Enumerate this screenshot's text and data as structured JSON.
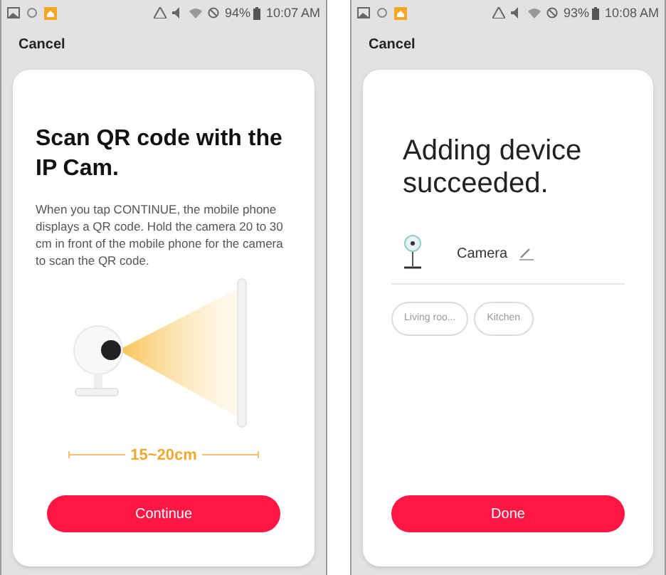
{
  "screens": [
    {
      "kind": "scan",
      "status_bar": {
        "battery": "94%",
        "time": "10:07 AM"
      },
      "cancel": "Cancel",
      "title": "Scan QR code with the IP Cam.",
      "body": "When you tap CONTINUE, the mobile phone displays a QR code. Hold the camera 20 to 30 cm in front of the mobile phone for the camera to scan the QR code.",
      "distance": "15~20cm",
      "button": "Continue"
    },
    {
      "kind": "done",
      "status_bar": {
        "battery": "93%",
        "time": "10:08 AM"
      },
      "cancel": "Cancel",
      "title": "Adding device succeeded.",
      "device_name": "Camera",
      "rooms": [
        {
          "label": "Living roo...",
          "selected": false
        },
        {
          "label": "Kitchen",
          "selected": false
        }
      ],
      "button": "Done"
    }
  ]
}
